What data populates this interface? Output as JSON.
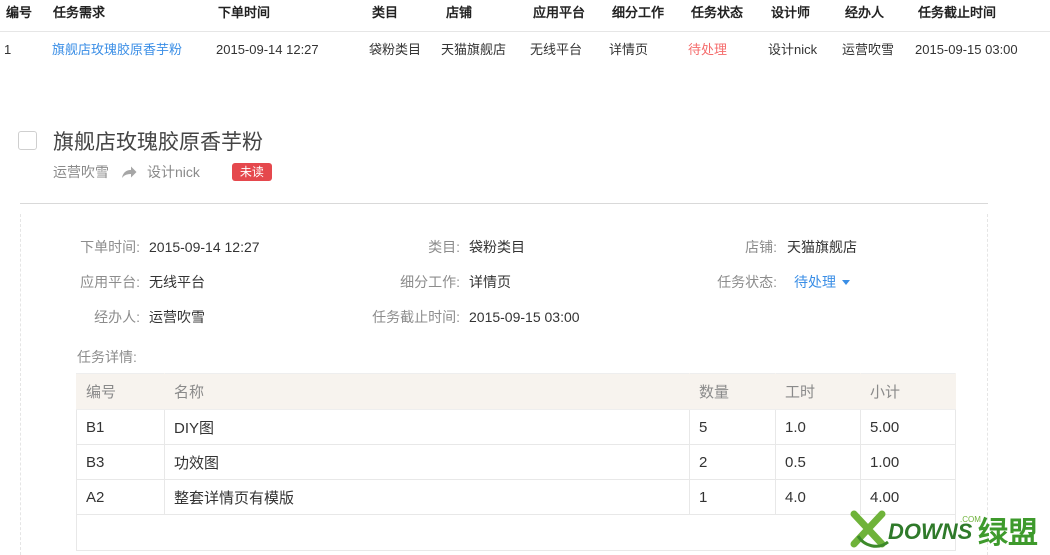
{
  "list": {
    "headers": [
      "编号",
      "任务需求",
      "下单时间",
      "类目",
      "店铺",
      "应用平台",
      "细分工作",
      "任务状态",
      "设计师",
      "经办人",
      "任务截止时间"
    ],
    "row": [
      "1",
      "旗舰店玫瑰胶原香芋粉",
      "2015-09-14 12:27",
      "袋粉类目",
      "天猫旗舰店",
      "无线平台",
      "详情页",
      "待处理",
      "设计nick",
      "运营吹雪",
      "2015-09-15 03:00"
    ]
  },
  "task": {
    "title": "旗舰店玫瑰胶原香芋粉",
    "from": "运营吹雪",
    "to": "设计nick",
    "badge": "未读"
  },
  "fields": {
    "order_time": {
      "label": "下单时间:",
      "value": "2015-09-14 12:27"
    },
    "category": {
      "label": "类目:",
      "value": "袋粉类目"
    },
    "shop": {
      "label": "店铺:",
      "value": "天猫旗舰店"
    },
    "platform": {
      "label": "应用平台:",
      "value": "无线平台"
    },
    "subwork": {
      "label": "细分工作:",
      "value": "详情页"
    },
    "status": {
      "label": "任务状态:",
      "value": "待处理"
    },
    "handler": {
      "label": "经办人:",
      "value": "运营吹雪"
    },
    "deadline": {
      "label": "任务截止时间:",
      "value": "2015-09-15 03:00"
    }
  },
  "details": {
    "label": "任务详情:",
    "columns": [
      "编号",
      "名称",
      "数量",
      "工时",
      "小计"
    ],
    "rows": [
      [
        "B1",
        "DIY图",
        "5",
        "1.0",
        "5.00"
      ],
      [
        "B3",
        "功效图",
        "2",
        "0.5",
        "1.00"
      ],
      [
        "A2",
        "整套详情页有模版",
        "1",
        "4.0",
        "4.00"
      ]
    ]
  },
  "watermark": {
    "brand": "DOWNS",
    "cn": "绿盟",
    "suffix": ".COM"
  },
  "colors": {
    "link": "#3a8ee6",
    "pending": "#f56c6c",
    "badge": "#e5484d",
    "header_bg": "#f7f3ee"
  }
}
